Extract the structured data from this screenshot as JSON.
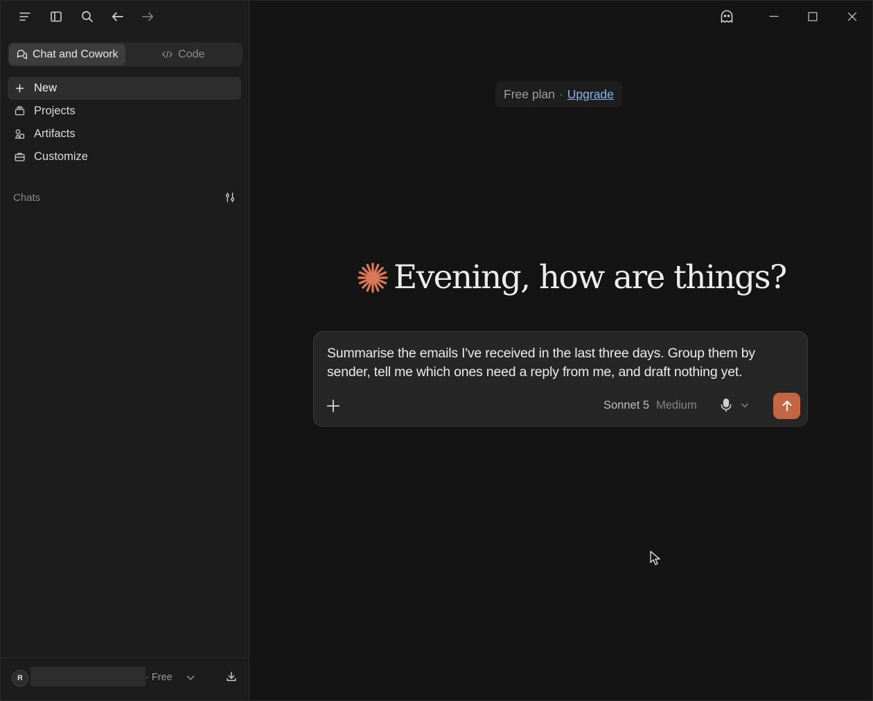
{
  "sidebar": {
    "mode_tabs": [
      {
        "label": "Chat and Cowork",
        "icon": "chat-bubbles-icon",
        "active": true
      },
      {
        "label": "Code",
        "icon": "code-icon",
        "active": false
      }
    ],
    "nav": [
      {
        "label": "New",
        "icon": "plus-icon"
      },
      {
        "label": "Projects",
        "icon": "folder-stack-icon"
      },
      {
        "label": "Artifacts",
        "icon": "shapes-icon"
      },
      {
        "label": "Customize",
        "icon": "briefcase-icon"
      }
    ],
    "chats_label": "Chats",
    "footer": {
      "avatar_initial": "R",
      "plan": "· Free"
    }
  },
  "main": {
    "plan_notice": {
      "free": "Free plan",
      "separator": "·",
      "upgrade": "Upgrade"
    },
    "greeting": "Evening, how are things?",
    "composer": {
      "prompt": "Summarise the emails I've received in the last three days. Group them by sender, tell me which ones need a reply from me, and draft nothing yet.",
      "model": "Sonnet 5",
      "effort": "Medium"
    }
  },
  "colors": {
    "accent": "#c36644",
    "link": "#8fb3ef",
    "sidebar_bg": "#1c1c1c",
    "main_bg": "#141414"
  }
}
